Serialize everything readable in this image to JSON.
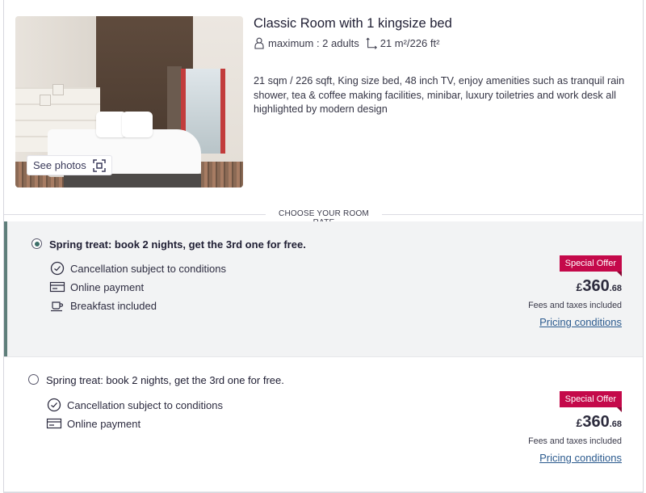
{
  "room": {
    "title": "Classic Room with 1 kingsize bed",
    "capacity": "maximum : 2 adults",
    "size": "21 m²/226 ft²",
    "description": "21 sqm / 226 sqft, King size bed, 48 inch TV, enjoy amenities such as tranquil rain shower, tea & coffee making facilities, minibar, luxury toiletries and work desk all highlighted by modern design",
    "see_photos_label": "See photos",
    "icons": {
      "capacity": "person-icon",
      "size": "area-icon",
      "gallery": "expand-icon"
    }
  },
  "section_label": "CHOOSE YOUR ROOM RATE",
  "rates": [
    {
      "selected": true,
      "name": "Spring treat: book 2 nights, get the 3rd one for free.",
      "features": [
        {
          "icon": "clock-icon",
          "label": "Cancellation subject to conditions"
        },
        {
          "icon": "credit-card-icon",
          "label": "Online payment"
        },
        {
          "icon": "coffee-cup-icon",
          "label": "Breakfast included"
        }
      ],
      "badge": "Special Offer",
      "currency": "£",
      "price_main": "360",
      "price_cents": ".68",
      "fees_note": "Fees and taxes included",
      "pricing_link": "Pricing conditions"
    },
    {
      "selected": false,
      "name": "Spring treat: book 2 nights, get the 3rd one for free.",
      "features": [
        {
          "icon": "clock-icon",
          "label": "Cancellation subject to conditions"
        },
        {
          "icon": "credit-card-icon",
          "label": "Online payment"
        }
      ],
      "badge": "Special Offer",
      "currency": "£",
      "price_main": "360",
      "price_cents": ".68",
      "fees_note": "Fees and taxes included",
      "pricing_link": "Pricing conditions"
    }
  ],
  "colors": {
    "accent_selected": "#5e7e7a",
    "badge": "#c4094a",
    "link": "#2b5a8e"
  }
}
